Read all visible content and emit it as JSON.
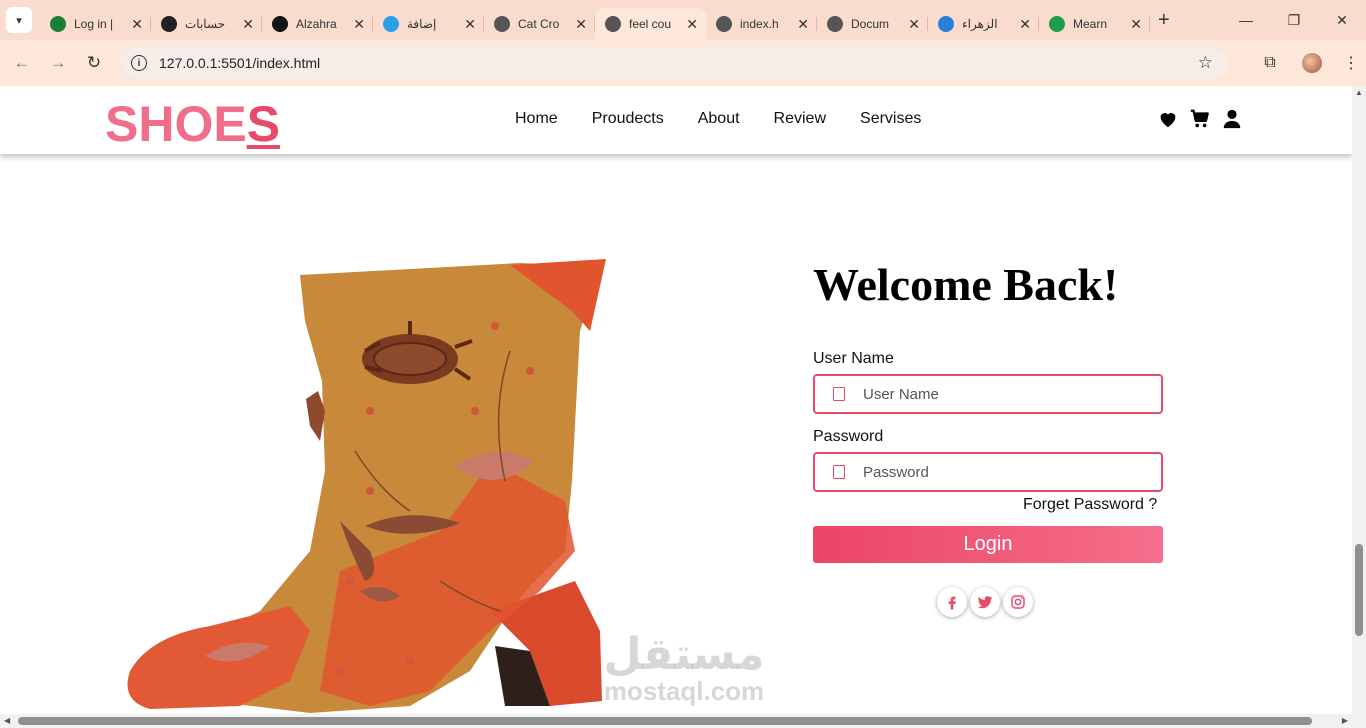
{
  "browser": {
    "tabs": [
      {
        "title": "Log in |",
        "favicon_color": "#1a7f37",
        "active": false
      },
      {
        "title": "حسابات",
        "favicon_color": "#222222",
        "active": false
      },
      {
        "title": "Alzahra",
        "favicon_color": "#111111",
        "active": false
      },
      {
        "title": "إضافة",
        "favicon_color": "#2aa0e8",
        "active": false
      },
      {
        "title": "Cat Cro",
        "favicon_color": "#555555",
        "active": false
      },
      {
        "title": "feel cou",
        "favicon_color": "#555555",
        "active": true
      },
      {
        "title": "index.h",
        "favicon_color": "#555555",
        "active": false
      },
      {
        "title": "Docum",
        "favicon_color": "#555555",
        "active": false
      },
      {
        "title": "الزهراء",
        "favicon_color": "#2a7fd8",
        "active": false
      },
      {
        "title": "Mearn",
        "favicon_color": "#1e9e4a",
        "active": false
      }
    ],
    "url": "127.0.0.1:5501/index.html"
  },
  "site": {
    "logo_main": "SHOE",
    "logo_last": "S",
    "nav": [
      "Home",
      "Proudects",
      "About",
      "Review",
      "Servises"
    ],
    "header_icons": [
      "heart-icon",
      "cart-icon",
      "user-icon"
    ]
  },
  "login": {
    "heading": "Welcome Back!",
    "username_label": "User Name",
    "username_placeholder": "User Name",
    "password_label": "Password",
    "password_placeholder": "Password",
    "forget": "Forget Password ?",
    "button": "Login",
    "socials": [
      "facebook-icon",
      "twitter-icon",
      "instagram-icon"
    ]
  },
  "watermark": {
    "arabic": "مستقل",
    "latin": "mostaql.com"
  },
  "colors": {
    "brand": "#f06e8a",
    "accent": "#e84a6b",
    "tabbar": "#f9dccd",
    "toolbar": "#fde6da"
  }
}
